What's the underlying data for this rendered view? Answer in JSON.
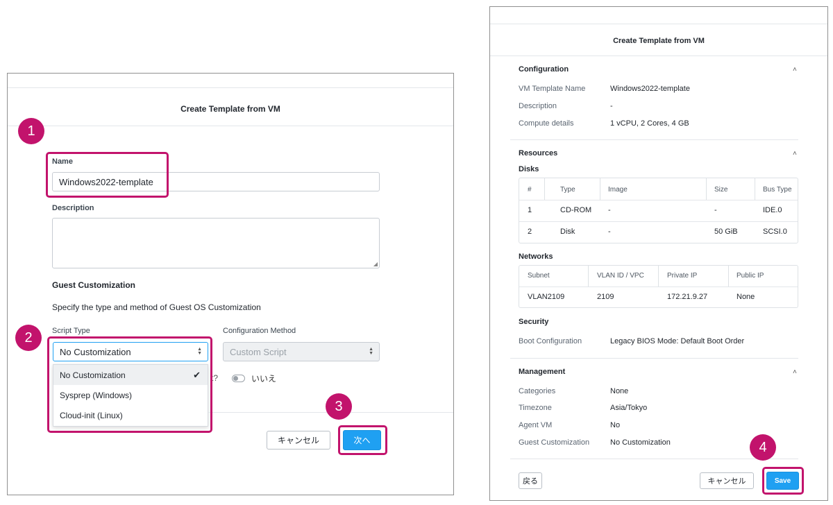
{
  "left": {
    "title": "Create Template from VM",
    "name_label": "Name",
    "name_value": "Windows2022-template",
    "description_label": "Description",
    "description_value": "",
    "guest_heading": "Guest Customization",
    "guest_text": "Specify the type and method of Guest OS Customization",
    "script_type_label": "Script Type",
    "script_type_value": "No Customization",
    "config_method_label": "Configuration Method",
    "config_method_value": "Custom Script",
    "dropdown_options": [
      "No Customization",
      "Sysprep (Windows)",
      "Cloud-init (Linux)"
    ],
    "partial_question": "t?",
    "toggle_label": "いいえ",
    "cancel": "キャンセル",
    "next": "次へ"
  },
  "right": {
    "title": "Create Template from VM",
    "configuration": {
      "heading": "Configuration",
      "rows": [
        {
          "k": "VM Template Name",
          "v": "Windows2022-template"
        },
        {
          "k": "Description",
          "v": "-"
        },
        {
          "k": "Compute details",
          "v": "1 vCPU, 2 Cores, 4 GB"
        }
      ]
    },
    "resources": {
      "heading": "Resources",
      "disks_label": "Disks",
      "disk_headers": [
        "#",
        "Type",
        "Image",
        "Size",
        "Bus Type"
      ],
      "disk_rows": [
        [
          "1",
          "CD-ROM",
          "-",
          "-",
          "IDE.0"
        ],
        [
          "2",
          "Disk",
          "-",
          "50 GiB",
          "SCSI.0"
        ]
      ],
      "networks_label": "Networks",
      "net_headers": [
        "Subnet",
        "VLAN ID / VPC",
        "Private IP",
        "Public IP"
      ],
      "net_rows": [
        [
          "VLAN2109",
          "2109",
          "172.21.9.27",
          "None"
        ]
      ]
    },
    "security": {
      "heading": "Security",
      "rows": [
        {
          "k": "Boot Configuration",
          "v": "Legacy BIOS Mode: Default Boot Order"
        }
      ]
    },
    "management": {
      "heading": "Management",
      "rows": [
        {
          "k": "Categories",
          "v": "None"
        },
        {
          "k": "Timezone",
          "v": "Asia/Tokyo"
        },
        {
          "k": "Agent VM",
          "v": "No"
        },
        {
          "k": "Guest Customization",
          "v": "No Customization"
        }
      ]
    },
    "back": "戻る",
    "cancel": "キャンセル",
    "save": "Save"
  },
  "badges": [
    "1",
    "2",
    "3",
    "4"
  ],
  "colors": {
    "accent": "#c2136c",
    "primary": "#1fa0f2"
  }
}
